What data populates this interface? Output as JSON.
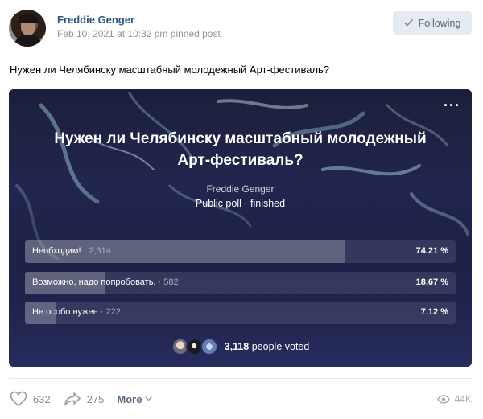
{
  "header": {
    "author": "Freddie Genger",
    "meta": "Feb 10, 2021 at 10:32 pm pinned post",
    "follow_label": "Following"
  },
  "post": {
    "text": "Нужен ли Челябинску масштабный молодежный Арт-фестиваль?"
  },
  "poll": {
    "title_line1": "Нужен ли Челябинску масштабный молодежный",
    "title_line2": "Арт-фестиваль?",
    "author": "Freddie Genger",
    "status": "Public poll · finished",
    "menu_icon": "more-dots-icon",
    "answers": [
      {
        "label": "Необходим!",
        "count": "· 2,314",
        "percent": "74.21 %",
        "share": 0.7421
      },
      {
        "label": "Возможно, надо попробовать.",
        "count": "· 582",
        "percent": "18.67 %",
        "share": 0.1867
      },
      {
        "label": "Не особо нужен",
        "count": "· 222",
        "percent": "7.12 %",
        "share": 0.0712
      }
    ],
    "voters_count": "3,118",
    "voters_suffix": "people voted"
  },
  "actions": {
    "likes": "632",
    "shares": "275",
    "more_label": "More",
    "views": "44K"
  },
  "colors": {
    "link": "#2a5885",
    "poll_bg": "#272c5e",
    "muted": "#828a99"
  }
}
